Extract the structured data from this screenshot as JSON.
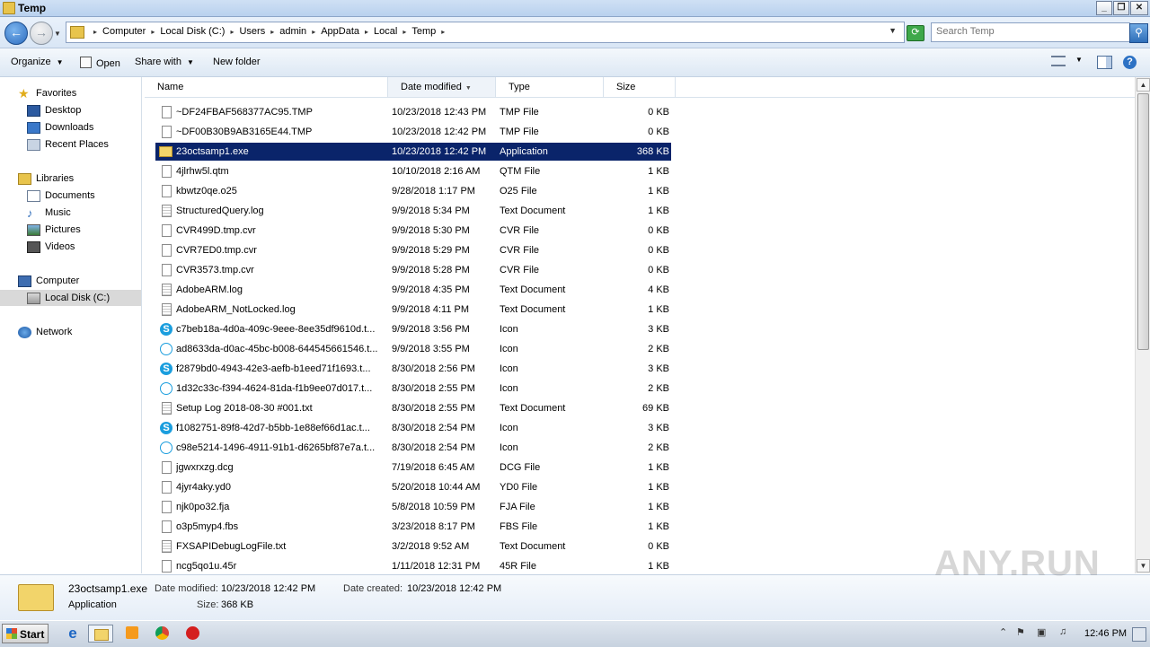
{
  "window": {
    "title": "Temp"
  },
  "window_buttons": {
    "minimize": "_",
    "restore": "❐",
    "close": "✕"
  },
  "address": {
    "crumbs": [
      "Computer",
      "Local Disk (C:)",
      "Users",
      "admin",
      "AppData",
      "Local",
      "Temp"
    ],
    "search_placeholder": "Search Temp"
  },
  "toolbar": {
    "organize": "Organize",
    "open": "Open",
    "share": "Share with",
    "new_folder": "New folder"
  },
  "nav": {
    "favorites": "Favorites",
    "desktop": "Desktop",
    "downloads": "Downloads",
    "recent": "Recent Places",
    "libraries": "Libraries",
    "documents": "Documents",
    "music": "Music",
    "pictures": "Pictures",
    "videos": "Videos",
    "computer": "Computer",
    "local_disk": "Local Disk (C:)",
    "network": "Network"
  },
  "columns": {
    "name": "Name",
    "date": "Date modified",
    "type": "Type",
    "size": "Size"
  },
  "files": [
    {
      "name": "~DF24FBAF568377AC95.TMP",
      "date": "10/23/2018 12:43 PM",
      "type": "TMP File",
      "size": "0 KB",
      "icon": "file-icon"
    },
    {
      "name": "~DF00B30B9AB3165E44.TMP",
      "date": "10/23/2018 12:42 PM",
      "type": "TMP File",
      "size": "0 KB",
      "icon": "file-icon"
    },
    {
      "name": "23octsamp1.exe",
      "date": "10/23/2018 12:42 PM",
      "type": "Application",
      "size": "368 KB",
      "icon": "folder-icon",
      "selected": true
    },
    {
      "name": "4jlrhw5l.qtm",
      "date": "10/10/2018 2:16 AM",
      "type": "QTM File",
      "size": "1 KB",
      "icon": "file-icon"
    },
    {
      "name": "kbwtz0qe.o25",
      "date": "9/28/2018 1:17 PM",
      "type": "O25 File",
      "size": "1 KB",
      "icon": "file-icon"
    },
    {
      "name": "StructuredQuery.log",
      "date": "9/9/2018 5:34 PM",
      "type": "Text Document",
      "size": "1 KB",
      "icon": "text-doc-icon"
    },
    {
      "name": "CVR499D.tmp.cvr",
      "date": "9/9/2018 5:30 PM",
      "type": "CVR File",
      "size": "0 KB",
      "icon": "file-icon"
    },
    {
      "name": "CVR7ED0.tmp.cvr",
      "date": "9/9/2018 5:29 PM",
      "type": "CVR File",
      "size": "0 KB",
      "icon": "file-icon"
    },
    {
      "name": "CVR3573.tmp.cvr",
      "date": "9/9/2018 5:28 PM",
      "type": "CVR File",
      "size": "0 KB",
      "icon": "file-icon"
    },
    {
      "name": "AdobeARM.log",
      "date": "9/9/2018 4:35 PM",
      "type": "Text Document",
      "size": "4 KB",
      "icon": "text-doc-icon"
    },
    {
      "name": "AdobeARM_NotLocked.log",
      "date": "9/9/2018 4:11 PM",
      "type": "Text Document",
      "size": "1 KB",
      "icon": "text-doc-icon"
    },
    {
      "name": "c7beb18a-4d0a-409c-9eee-8ee35df9610d.t...",
      "date": "9/9/2018 3:56 PM",
      "type": "Icon",
      "size": "3 KB",
      "icon": "skype-icon"
    },
    {
      "name": "ad8633da-d0ac-45bc-b008-644545661546.t...",
      "date": "9/9/2018 3:55 PM",
      "type": "Icon",
      "size": "2 KB",
      "icon": "skype-outline-icon"
    },
    {
      "name": "f2879bd0-4943-42e3-aefb-b1eed71f1693.t...",
      "date": "8/30/2018 2:56 PM",
      "type": "Icon",
      "size": "3 KB",
      "icon": "skype-icon"
    },
    {
      "name": "1d32c33c-f394-4624-81da-f1b9ee07d017.t...",
      "date": "8/30/2018 2:55 PM",
      "type": "Icon",
      "size": "2 KB",
      "icon": "skype-outline-icon"
    },
    {
      "name": "Setup Log 2018-08-30 #001.txt",
      "date": "8/30/2018 2:55 PM",
      "type": "Text Document",
      "size": "69 KB",
      "icon": "text-doc-icon"
    },
    {
      "name": "f1082751-89f8-42d7-b5bb-1e88ef66d1ac.t...",
      "date": "8/30/2018 2:54 PM",
      "type": "Icon",
      "size": "3 KB",
      "icon": "skype-icon"
    },
    {
      "name": "c98e5214-1496-4911-91b1-d6265bf87e7a.t...",
      "date": "8/30/2018 2:54 PM",
      "type": "Icon",
      "size": "2 KB",
      "icon": "skype-outline-icon"
    },
    {
      "name": "jgwxrxzg.dcg",
      "date": "7/19/2018 6:45 AM",
      "type": "DCG File",
      "size": "1 KB",
      "icon": "file-icon"
    },
    {
      "name": "4jyr4aky.yd0",
      "date": "5/20/2018 10:44 AM",
      "type": "YD0 File",
      "size": "1 KB",
      "icon": "file-icon"
    },
    {
      "name": "njk0po32.fja",
      "date": "5/8/2018 10:59 PM",
      "type": "FJA File",
      "size": "1 KB",
      "icon": "file-icon"
    },
    {
      "name": "o3p5myp4.fbs",
      "date": "3/23/2018 8:17 PM",
      "type": "FBS File",
      "size": "1 KB",
      "icon": "file-icon"
    },
    {
      "name": "FXSAPIDebugLogFile.txt",
      "date": "3/2/2018 9:52 AM",
      "type": "Text Document",
      "size": "0 KB",
      "icon": "text-doc-icon"
    },
    {
      "name": "ncg5qo1u.45r",
      "date": "1/11/2018 12:31 PM",
      "type": "45R File",
      "size": "1 KB",
      "icon": "file-icon"
    }
  ],
  "details": {
    "name": "23octsamp1.exe",
    "type": "Application",
    "modified_label": "Date modified:",
    "modified": "10/23/2018 12:42 PM",
    "created_label": "Date created:",
    "created": "10/23/2018 12:42 PM",
    "size_label": "Size:",
    "size": "368 KB"
  },
  "watermark": "ANY.RUN",
  "taskbar": {
    "start": "Start",
    "clock": "12:46 PM"
  }
}
